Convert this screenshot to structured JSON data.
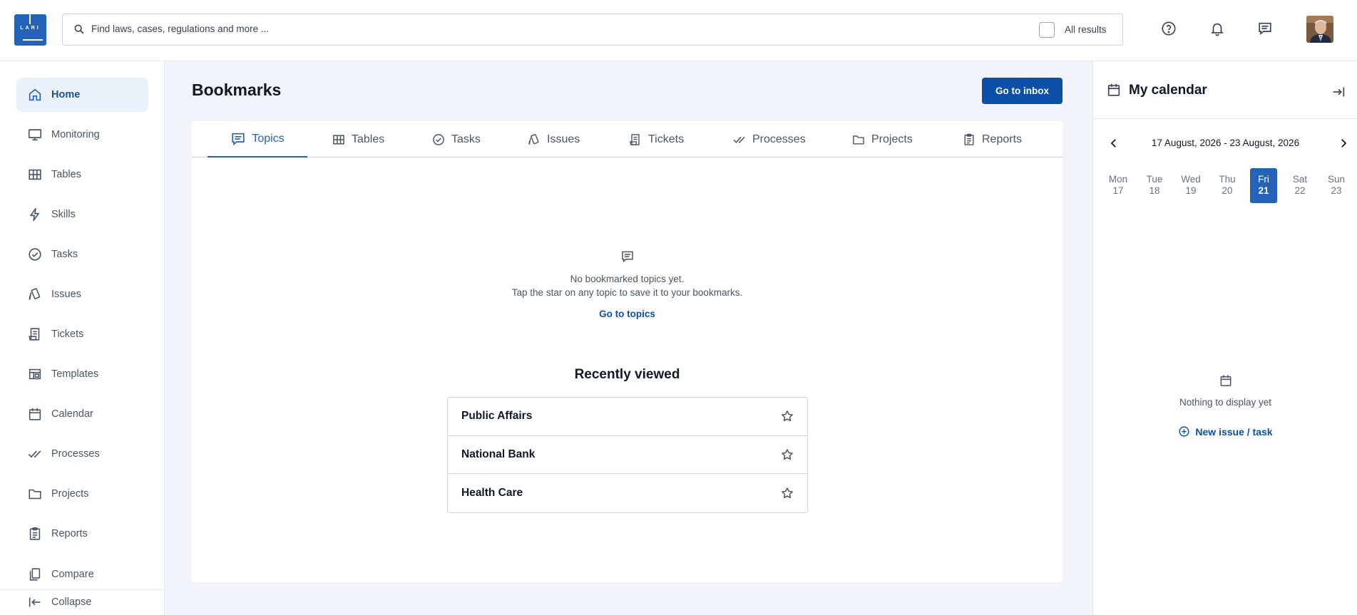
{
  "header": {
    "logo_text": "LARI",
    "search_placeholder": "Find laws, cases, regulations and more ...",
    "all_results_label": "All results",
    "icons": [
      "help-icon",
      "bell-icon",
      "message-icon"
    ]
  },
  "sidebar": {
    "items": [
      {
        "label": "Home",
        "icon": "home-icon",
        "active": true
      },
      {
        "label": "Monitoring",
        "icon": "monitor-icon"
      },
      {
        "label": "Tables",
        "icon": "table-icon"
      },
      {
        "label": "Skills",
        "icon": "lightning-icon"
      },
      {
        "label": "Tasks",
        "icon": "check-circle-icon"
      },
      {
        "label": "Issues",
        "icon": "issues-icon"
      },
      {
        "label": "Tickets",
        "icon": "ticket-icon"
      },
      {
        "label": "Templates",
        "icon": "template-icon"
      },
      {
        "label": "Calendar",
        "icon": "calendar-icon"
      },
      {
        "label": "Processes",
        "icon": "double-check-icon"
      },
      {
        "label": "Projects",
        "icon": "folder-icon"
      },
      {
        "label": "Reports",
        "icon": "clipboard-icon"
      },
      {
        "label": "Compare",
        "icon": "compare-icon"
      }
    ],
    "collapse_label": "Collapse"
  },
  "main": {
    "title": "Bookmarks",
    "inbox_button": "Go to inbox",
    "tabs": [
      {
        "label": "Topics",
        "active": true
      },
      {
        "label": "Tables"
      },
      {
        "label": "Tasks"
      },
      {
        "label": "Issues"
      },
      {
        "label": "Tickets"
      },
      {
        "label": "Processes"
      },
      {
        "label": "Projects"
      },
      {
        "label": "Reports"
      }
    ],
    "empty_state": {
      "line1": "No bookmarked topics yet.",
      "line2": "Tap the star on any topic to save it to your bookmarks.",
      "link": "Go to topics"
    },
    "recently_viewed": {
      "title": "Recently viewed",
      "items": [
        "Public Affairs",
        "National Bank",
        "Health Care"
      ]
    }
  },
  "calendar": {
    "title": "My calendar",
    "range": "17 August, 2026 - 23 August, 2026",
    "days": [
      {
        "name": "Mon",
        "num": "17"
      },
      {
        "name": "Tue",
        "num": "18"
      },
      {
        "name": "Wed",
        "num": "19"
      },
      {
        "name": "Thu",
        "num": "20"
      },
      {
        "name": "Fri",
        "num": "21",
        "active": true
      },
      {
        "name": "Sat",
        "num": "22"
      },
      {
        "name": "Sun",
        "num": "23"
      }
    ],
    "empty_text": "Nothing to display yet",
    "new_button": "New issue / task"
  },
  "colors": {
    "accent": "#2563b8",
    "primary_button": "#0b4fa8",
    "main_background": "#f1f5fb"
  }
}
